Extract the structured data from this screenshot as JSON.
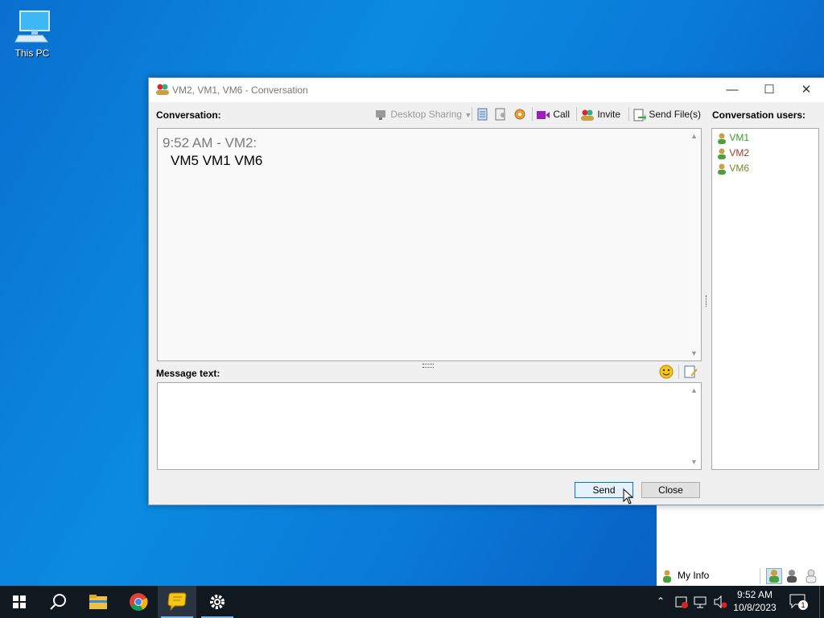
{
  "desktop": {
    "icon_label": "This PC",
    "icon_name": "computer-icon"
  },
  "window": {
    "title": "VM2, VM1, VM6 - Conversation",
    "min_icon": "minimize-icon",
    "max_icon": "maximize-icon",
    "close_icon": "close-icon",
    "conversation_label": "Conversation:",
    "toolbar": {
      "desktop_sharing": "Desktop Sharing",
      "call": "Call",
      "invite": "Invite",
      "send_files": "Send File(s)"
    },
    "messages": [
      {
        "header": "9:52 AM - VM2:",
        "text": "VM5 VM1 VM6"
      }
    ],
    "message_text_label": "Message text:",
    "message_value": "",
    "users_label": "Conversation users:",
    "users": [
      {
        "name": "VM1",
        "color": "#3a9a28"
      },
      {
        "name": "VM2",
        "color": "#a03a2a"
      },
      {
        "name": "VM6",
        "color": "#7a8a20"
      }
    ],
    "send_label": "Send",
    "close_label": "Close"
  },
  "background_app": {
    "my_info": "My Info"
  },
  "taskbar": {
    "items": [
      "start-icon",
      "search-icon",
      "file-explorer-icon",
      "chrome-icon",
      "messenger-icon",
      "settings-icon"
    ],
    "time": "9:52 AM",
    "date": "10/8/2023",
    "notification_count": "1"
  }
}
